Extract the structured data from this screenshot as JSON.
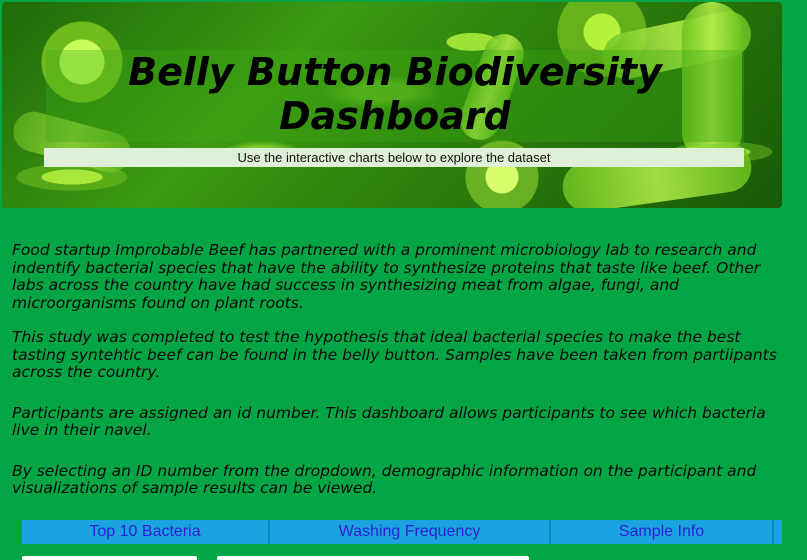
{
  "header": {
    "title": "Belly Button Biodiversity Dashboard",
    "subtitle": "Use the interactive charts below to explore the dataset"
  },
  "intro": {
    "paragraphs": [
      "Food startup Improbable Beef has partnered with a prominent microbiology lab to research and indentify bacterial species that have the ability to synthesize proteins that taste like beef. Other labs across the country have had success in synthesizing meat from algae, fungi, and microorganisms found on plant roots.",
      "This study was completed to test the hypothesis that ideal bacterial species to make the best tasting syntehtic beef can be found in the belly button. Samples have been taken from partiipants across the country.",
      "Participants are assigned an id number. This dashboard allows participants to see which bacteria live in their navel.",
      "By selecting an ID number from the dropdown, demographic information on the participant and visualizations of sample results can be viewed."
    ]
  },
  "tabs": [
    {
      "label": "Top 10 Bacteria"
    },
    {
      "label": "Washing Frequency"
    },
    {
      "label": "Sample Info"
    }
  ],
  "colors": {
    "page_background": "#04a544",
    "tab_bar": "#1ba3e0",
    "tab_text": "#2b1fd6"
  }
}
